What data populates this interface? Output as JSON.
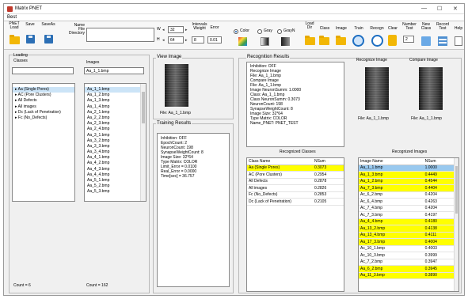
{
  "window": {
    "title": "Matrix PNET",
    "minimize": "—",
    "maximize": "☐",
    "close": "✕"
  },
  "menu_tab": "Best",
  "toolbar": {
    "pnet_load": "PNET\nLoad",
    "save": "Save",
    "save_as": "SaveAs",
    "name_label": "Name\nFile\nDirectory",
    "name_value": "",
    "w_label": "W",
    "w_value": "32",
    "h_label": "H",
    "h_value": "64",
    "intervals_label": "Intervals\nWeight",
    "intervals_value": "8",
    "error_label": "Error",
    "error_value": "0.01",
    "mode_options": [
      "Color",
      "Gray",
      "GrayN"
    ],
    "mode_selected": "Color",
    "load_label": "Load\nDir",
    "class_label": "Class",
    "image_label": "Image",
    "train_label": "Train",
    "recogn_label": "Recogn",
    "clear_label": "Clear",
    "number_test_label": "Number\nTest",
    "number_test_value": "2",
    "new_class_label": "New\nClass",
    "record_test_label": "Record\nTest",
    "help_label": "Help"
  },
  "loading_classes": {
    "title": "Loading\nClasses",
    "search_value": "",
    "items": [
      {
        "label": "Aa (Single Pores)",
        "selected": true
      },
      {
        "label": "AC (Pore Clusters)",
        "selected": false
      },
      {
        "label": "All Defects",
        "selected": false
      },
      {
        "label": "All images",
        "selected": false
      },
      {
        "label": "Dc (Lack of Penetration)",
        "selected": false
      },
      {
        "label": "Fc (No_Defects)",
        "selected": false
      }
    ],
    "count": "Count = 6"
  },
  "images": {
    "title": "Images",
    "search_value": "Aa_1_1.bmp",
    "items": [
      "Aa_1_1.bmp",
      "Aa_1_2.bmp",
      "Aa_1_3.bmp",
      "Aa_1_4.bmp",
      "Aa_2_1.bmp",
      "Aa_2_2.bmp",
      "Aa_2_3.bmp",
      "Aa_2_4.bmp",
      "Aa_3_1.bmp",
      "Aa_3_2.bmp",
      "Aa_3_3.bmp",
      "Aa_3_4.bmp",
      "Aa_4_1.bmp",
      "Aa_4_2.bmp",
      "Aa_4_3.bmp",
      "Aa_4_4.bmp",
      "Aa_5_1.bmp",
      "Aa_5_2.bmp",
      "Aa_5_3.bmp"
    ],
    "count": "Count = 162"
  },
  "view_image": {
    "title": "View Image",
    "file": "File:  Aa_1_1.bmp"
  },
  "training_results": {
    "title": "Training Results",
    "lines": [
      "Inhibition:  OFF",
      "EpochCount: 2",
      "NeuronCount: 198",
      "SynapseWeightCount: 8",
      "Image Size: 32*64",
      "Type Matrix: COLOR",
      "Limit_Error = 0.0100",
      "Real_Error = 0.0000",
      "Time[sec] = 36.757"
    ]
  },
  "recognition_results": {
    "title": "Recognition Results",
    "lines": [
      "Inhibition:  OFF",
      "Recognize Image",
      "File: Aa_1_1.bmp",
      "Compare Image",
      "File: Aa_1_1.bmp",
      "Image NeuronSumm: 1.0000",
      "Class: Aa_1_1.bmp",
      "Class NeuronSumm: 0.3073",
      "NeuronCount: 198",
      "SynapseWeightCount: 8",
      "Image Size: 32*64",
      "Type Matrix: COLOR",
      "Name_PNET: PNET_TEST"
    ]
  },
  "recognize_image": {
    "title": "Recognize Image",
    "file": "File:  Aa_1_1.bmp"
  },
  "compare_image": {
    "title": "Compare Image",
    "file": "File:  Aa_1_1.bmp"
  },
  "recognized_classes": {
    "title": "Recognized Classes",
    "headers": [
      "Class Name",
      "NSum"
    ],
    "rows": [
      {
        "name": "Aa (Single Pores)",
        "nsum": "0.3073",
        "hl": true
      },
      {
        "name": "AC (Pore Clusters)",
        "nsum": "0.2954",
        "hl": false
      },
      {
        "name": "All Defects",
        "nsum": "0.2878",
        "hl": false
      },
      {
        "name": "All images",
        "nsum": "0.2826",
        "hl": false
      },
      {
        "name": "Fc (No_Defects)",
        "nsum": "0.2853",
        "hl": false
      },
      {
        "name": "Dc (Lack of Penetration)",
        "nsum": "0.2105",
        "hl": false
      }
    ]
  },
  "recognized_images": {
    "title": "Recognized Images",
    "headers": [
      "Image Name",
      "NSum"
    ],
    "rows": [
      {
        "name": "Aa_1_1.bmp",
        "nsum": "1.0000",
        "hl": "sel"
      },
      {
        "name": "Aa_1_3.bmp",
        "nsum": "0.4449",
        "hl": "yes"
      },
      {
        "name": "Aa_1_2.bmp",
        "nsum": "0.4544",
        "hl": "yes"
      },
      {
        "name": "Aa_7_3.bmp",
        "nsum": "0.4404",
        "hl": "yes"
      },
      {
        "name": "Ac_6_2.bmp",
        "nsum": "0.4204",
        "hl": "no"
      },
      {
        "name": "Ac_6_4.bmp",
        "nsum": "0.4263",
        "hl": "no"
      },
      {
        "name": "Ac_7_4.bmp",
        "nsum": "0.4204",
        "hl": "no"
      },
      {
        "name": "Ac_7_3.bmp",
        "nsum": "0.4197",
        "hl": "no"
      },
      {
        "name": "Aa_4_4.bmp",
        "nsum": "0.4180",
        "hl": "yes"
      },
      {
        "name": "Aa_13_2.bmp",
        "nsum": "0.4138",
        "hl": "yes"
      },
      {
        "name": "Aa_13_4.bmp",
        "nsum": "0.4111",
        "hl": "yes"
      },
      {
        "name": "Aa_17_3.bmp",
        "nsum": "0.4004",
        "hl": "yes"
      },
      {
        "name": "Ac_10_1.bmp",
        "nsum": "0.4003",
        "hl": "no"
      },
      {
        "name": "Ac_10_3.bmp",
        "nsum": "0.3999",
        "hl": "no"
      },
      {
        "name": "Ac_7_2.bmp",
        "nsum": "0.3947",
        "hl": "no"
      },
      {
        "name": "Aa_6_2.bmp",
        "nsum": "0.3945",
        "hl": "yes"
      },
      {
        "name": "Aa_11_3.bmp",
        "nsum": "0.3890",
        "hl": "yes"
      }
    ]
  }
}
